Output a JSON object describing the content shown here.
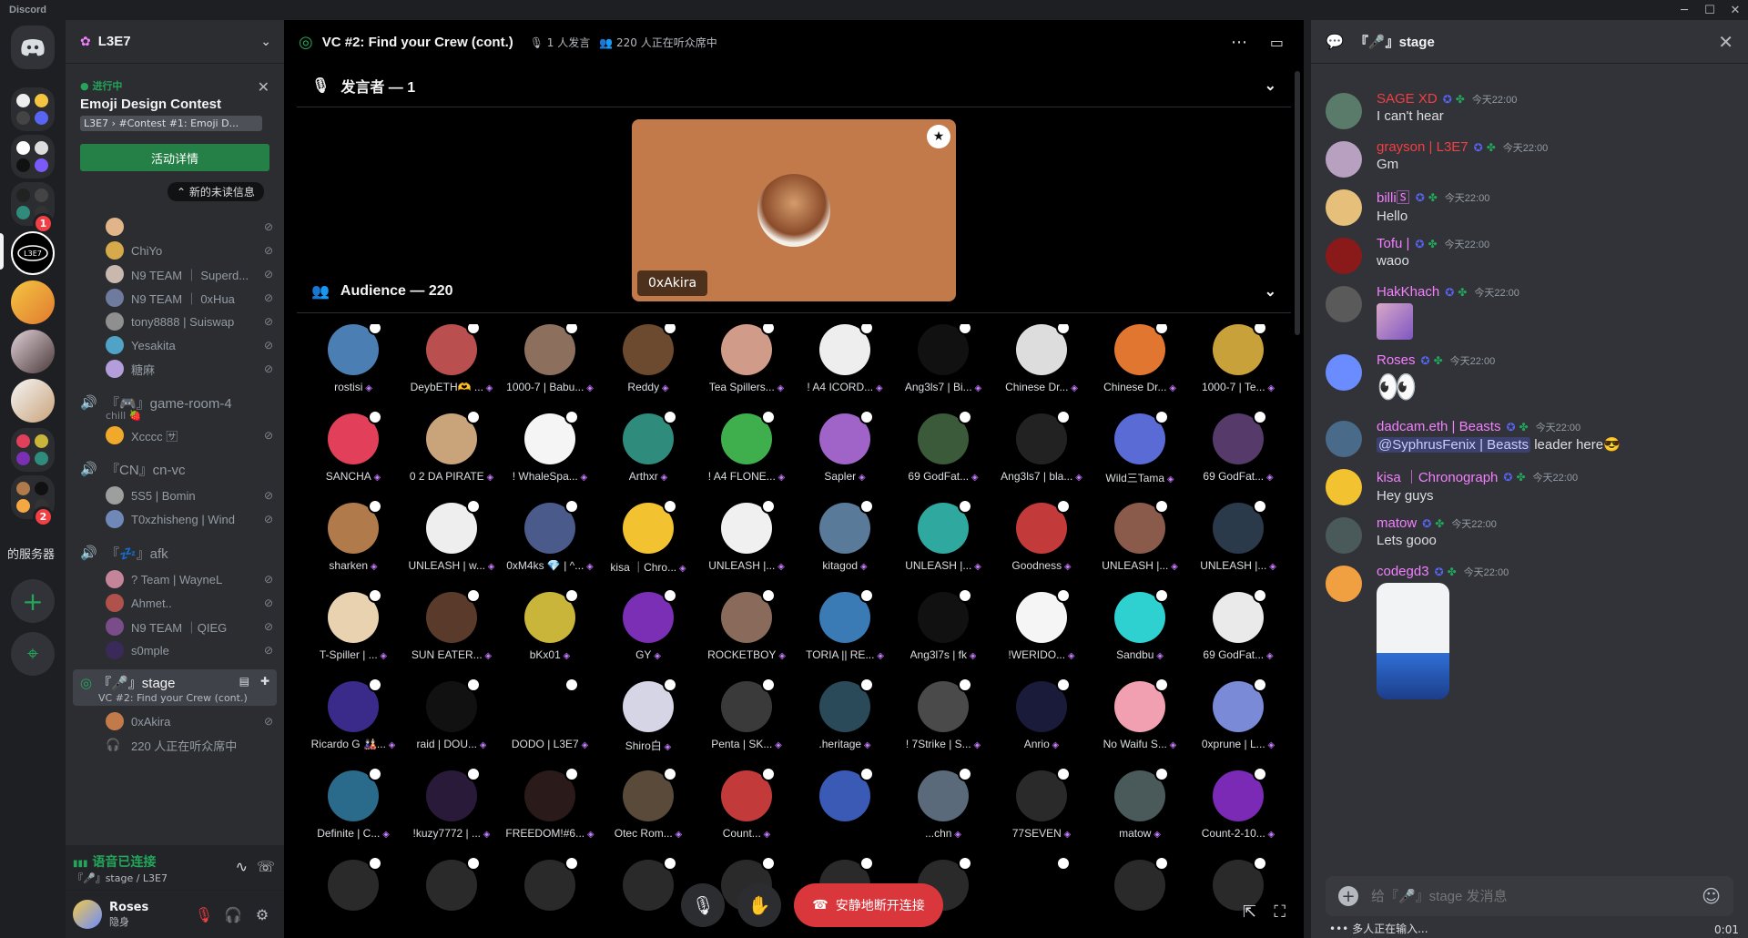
{
  "window": {
    "title": "Discord",
    "controls": [
      "─",
      "☐",
      "✕"
    ]
  },
  "rail": {
    "server_label": "的服务器",
    "badges": [
      "1",
      "2"
    ],
    "add_server": "+",
    "explore": "⌖"
  },
  "sidebar": {
    "server_name": "L3E7",
    "event": {
      "status": "进行中",
      "name": "Emoji Design Contest",
      "location": "L3E7 › #Contest #1: Emoji D...",
      "button": "活动详情"
    },
    "new_messages": "新的未读信息",
    "top_users": [
      {
        "name": "",
        "color": "#e2b48a"
      },
      {
        "name": "ChiYo",
        "color": "#d6a94a"
      },
      {
        "name": "N9 TEAM ｜ Superd...",
        "color": "#c9b8ae"
      },
      {
        "name": "N9 TEAM ｜ 0xHua",
        "color": "#6e7b9e"
      },
      {
        "name": "tony8888 | Suiswap",
        "color": "#8f8f8f"
      },
      {
        "name": "Yesakita",
        "color": "#4fa3c7"
      },
      {
        "name": "糖麻",
        "color": "#b39ddb"
      }
    ],
    "channel_game_room": {
      "name": "『🎮』game-room-4",
      "sub": "chill 🍓",
      "users": [
        {
          "name": "Xcccc 🈂",
          "color": "#f0a92b"
        }
      ]
    },
    "channel_cn": {
      "name": "『CN』cn-vc",
      "users": [
        {
          "name": "5S5 | Bomin",
          "color": "#9e9e9e"
        },
        {
          "name": "T0xzhisheng | Wind",
          "color": "#6f88b8"
        }
      ]
    },
    "channel_afk": {
      "name": "『💤』afk",
      "users": [
        {
          "name": "? Team | WayneL",
          "color": "#c4859a"
        },
        {
          "name": "Ahmet..",
          "color": "#b0524b"
        },
        {
          "name": "N9 TEAM ｜QIEG",
          "color": "#7a4c8a"
        },
        {
          "name": "s0mple",
          "color": "#3a2a5a"
        }
      ]
    },
    "stage_channel": {
      "name": "『🎤』stage",
      "sub": "VC #2: Find your Crew (cont.)"
    },
    "stage_users": [
      {
        "name": "0xAkira",
        "color": "#c27a4a"
      }
    ],
    "listeners": "220 人正在听众席中",
    "voice": {
      "status": "语音已连接",
      "channel": "『🎤』stage / L3E7"
    },
    "user": {
      "name": "Roses",
      "status": "隐身"
    }
  },
  "stage": {
    "title": "VC #2: Find your Crew (cont.)",
    "speaker_count": "1 人发言",
    "listener_count": "220 人正在听众席中",
    "speakers_label": "发言者 — 1",
    "speaker": {
      "name": "0xAkira"
    },
    "audience_label": "Audience — 220",
    "audience": [
      {
        "name": "rostisi",
        "color": "#4b7fb3"
      },
      {
        "name": "DeybETH🫶 ...",
        "color": "#b94f4f"
      },
      {
        "name": "1000-7 | Babu...",
        "color": "#8c6f5c"
      },
      {
        "name": "Reddy",
        "color": "#6b4a2f"
      },
      {
        "name": "Tea Spillers...",
        "color": "#d19b8a"
      },
      {
        "name": "! A4 ICORD...",
        "color": "#eeeeee"
      },
      {
        "name": "Ang3ls7 | Bi...",
        "color": "#111111"
      },
      {
        "name": "Chinese Dr...",
        "color": "#dddddd"
      },
      {
        "name": "Chinese Dr...",
        "color": "#e0762f"
      },
      {
        "name": "1000-7 | Te...",
        "color": "#c9a13a"
      },
      {
        "name": "SANCHA",
        "color": "#e2405a"
      },
      {
        "name": "0 2 DA PIRATE",
        "color": "#c9a37a"
      },
      {
        "name": "! WhaleSpa...",
        "color": "#f5f5f5"
      },
      {
        "name": "Arthxr",
        "color": "#2f8c7c"
      },
      {
        "name": "! A4 FLONE...",
        "color": "#3fae4c"
      },
      {
        "name": "Sapler",
        "color": "#a063c7"
      },
      {
        "name": "69 GodFat...",
        "color": "#3a5a3a"
      },
      {
        "name": "Ang3ls7 | bla...",
        "color": "#222222"
      },
      {
        "name": "Wild三Tama",
        "color": "#5a6bd6"
      },
      {
        "name": "69 GodFat...",
        "color": "#553a6a"
      },
      {
        "name": "sharken",
        "color": "#b07a4a"
      },
      {
        "name": "UNLEASH | w...",
        "color": "#eeeeee"
      },
      {
        "name": "0xM4ks 💎 | ^...",
        "color": "#4a5a8a"
      },
      {
        "name": "kisa ｜Chro...",
        "color": "#f2c230"
      },
      {
        "name": "UNLEASH |...",
        "color": "#f0f0f0"
      },
      {
        "name": "kitagod",
        "color": "#5a7a9a"
      },
      {
        "name": "UNLEASH |...",
        "color": "#2fa9a0"
      },
      {
        "name": "Goodness",
        "color": "#c23a3a"
      },
      {
        "name": "UNLEASH |...",
        "color": "#8a5a4a"
      },
      {
        "name": "UNLEASH |...",
        "color": "#2a3a4a"
      },
      {
        "name": "T-Spiller | ...",
        "color": "#e8d2b0"
      },
      {
        "name": "SUN EATER...",
        "color": "#5a3a2a"
      },
      {
        "name": "bKx01",
        "color": "#c9b53a"
      },
      {
        "name": "GY",
        "color": "#7a2fb5"
      },
      {
        "name": "ROCKETBOY",
        "color": "#8a6a5a"
      },
      {
        "name": "TORIA || RE...",
        "color": "#3a7ab5"
      },
      {
        "name": "Ang3l7s | fk",
        "color": "#111111"
      },
      {
        "name": "!WERIDO...",
        "color": "#f5f5f5"
      },
      {
        "name": "Sandbu",
        "color": "#2fd0d0"
      },
      {
        "name": "69 GodFat...",
        "color": "#eaeaea"
      },
      {
        "name": "Ricardo G 🎎...",
        "color": "#3a2a8a"
      },
      {
        "name": "raid | DOU...",
        "color": "#111111"
      },
      {
        "name": "DODO | L3E7",
        "color": "#000000"
      },
      {
        "name": "Shiro白",
        "color": "#d5d5e5"
      },
      {
        "name": "Penta | SK...",
        "color": "#3a3a3a"
      },
      {
        "name": ".heritage",
        "color": "#2a4a5a"
      },
      {
        "name": "! 7Strike | S...",
        "color": "#4a4a4a"
      },
      {
        "name": "Anrio",
        "color": "#1a1a3a"
      },
      {
        "name": "No Waifu S...",
        "color": "#f0a0b0"
      },
      {
        "name": "0xprune | L...",
        "color": "#7a8ad6"
      },
      {
        "name": "Definite | C...",
        "color": "#2a6a8a"
      },
      {
        "name": "!kuzy7772 | ...",
        "color": "#2a1a3a"
      },
      {
        "name": "FREEDOM!#6...",
        "color": "#2a1a1a"
      },
      {
        "name": "Otec Rom...",
        "color": "#5a4a3a"
      },
      {
        "name": "Count...",
        "color": "#c23a3a"
      },
      {
        "name": "",
        "color": "#3a5ab5"
      },
      {
        "name": "...chn",
        "color": "#5a6a7a"
      },
      {
        "name": "77SEVEN",
        "color": "#2a2a2a"
      },
      {
        "name": "matow",
        "color": "#4a5a5a"
      },
      {
        "name": "Count-2-10...",
        "color": "#7a2ab5"
      },
      {
        "name": "",
        "color": "#2a2a2a"
      },
      {
        "name": "",
        "color": "#2a2a2a"
      },
      {
        "name": "",
        "color": "#2a2a2a"
      },
      {
        "name": "",
        "color": "#2a2a2a"
      },
      {
        "name": "",
        "color": "#2a2a2a"
      },
      {
        "name": "",
        "color": "#2a2a2a"
      },
      {
        "name": "",
        "color": "#2a2a2a"
      },
      {
        "name": "",
        "color": "#000000"
      },
      {
        "name": "",
        "color": "#2a2a2a"
      },
      {
        "name": "",
        "color": "#2a2a2a"
      }
    ],
    "leave_button": "安静地断开连接"
  },
  "chat": {
    "title": "『🎤』stage",
    "messages": [
      {
        "user": "SAGE XD",
        "color": "#f23f43",
        "time": "今天22:00",
        "text": "I can't hear",
        "avatar": "#5a7a6a"
      },
      {
        "user": "grayson | L3E7",
        "color": "#f23f43",
        "time": "今天22:00",
        "text": "Gm",
        "avatar": "#b7a0c0"
      },
      {
        "user": "billi🅂",
        "color": "#f47fff",
        "time": "今天22:00",
        "text": "Hello",
        "avatar": "#e6c07a"
      },
      {
        "user": "Tofu |",
        "color": "#f47fff",
        "time": "今天22:00",
        "text": "waoo",
        "avatar": "#8a1a1a"
      },
      {
        "user": "HakKhach",
        "color": "#f47fff",
        "time": "今天22:00",
        "text": "",
        "avatar": "#5a5a5a"
      },
      {
        "user": "Roses",
        "color": "#f47fff",
        "time": "今天22:00",
        "text": "👀",
        "avatar": "#6b8cff"
      },
      {
        "user": "dadcam.eth | Beasts",
        "color": "#f47fff",
        "time": "今天22:00",
        "text": "leader here😎",
        "mention": "@SyphrusFenix | Beasts",
        "avatar": "#4a6a8a"
      },
      {
        "user": "kisa ｜Chronograph",
        "color": "#f47fff",
        "time": "今天22:00",
        "text": "Hey guys",
        "avatar": "#f2c230"
      },
      {
        "user": "matow",
        "color": "#f47fff",
        "time": "今天22:00",
        "text": "Lets gooo",
        "avatar": "#4a5a5a"
      },
      {
        "user": "codegd3",
        "color": "#f47fff",
        "time": "今天22:00",
        "text": "",
        "avatar": "#f0a040"
      }
    ],
    "placeholder": "给『🎤』stage 发消息",
    "typing": "多人正在输入...",
    "timer": "0:01"
  }
}
